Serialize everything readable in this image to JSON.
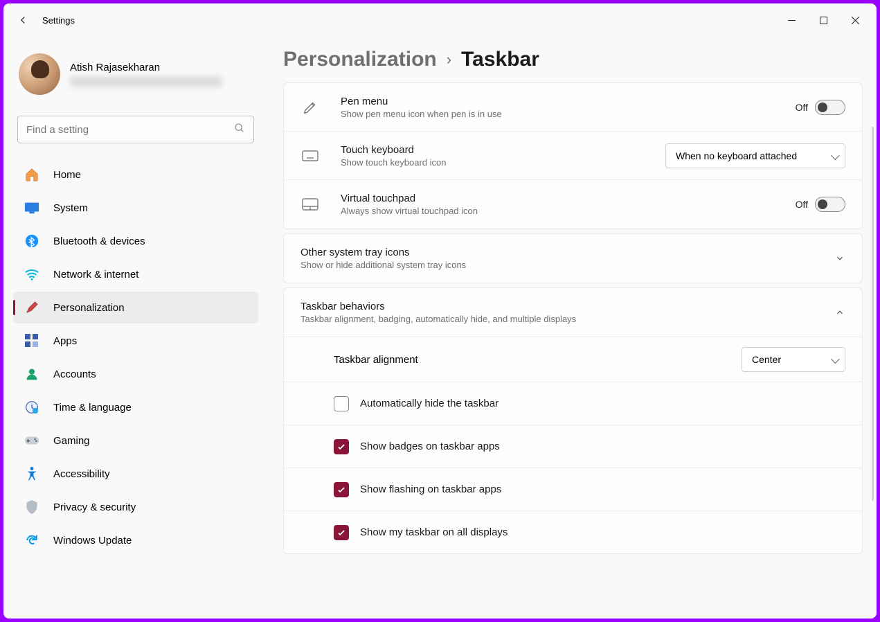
{
  "app": {
    "title": "Settings"
  },
  "wincontrols": {
    "min": "–",
    "max": "▢",
    "close": "✕"
  },
  "profile": {
    "name": "Atish Rajasekharan"
  },
  "search": {
    "placeholder": "Find a setting"
  },
  "nav": {
    "items": [
      {
        "label": "Home",
        "icon": "home"
      },
      {
        "label": "System",
        "icon": "system"
      },
      {
        "label": "Bluetooth & devices",
        "icon": "bluetooth"
      },
      {
        "label": "Network & internet",
        "icon": "wifi"
      },
      {
        "label": "Personalization",
        "icon": "brush",
        "active": true
      },
      {
        "label": "Apps",
        "icon": "apps"
      },
      {
        "label": "Accounts",
        "icon": "accounts"
      },
      {
        "label": "Time & language",
        "icon": "time"
      },
      {
        "label": "Gaming",
        "icon": "gaming"
      },
      {
        "label": "Accessibility",
        "icon": "accessibility"
      },
      {
        "label": "Privacy & security",
        "icon": "privacy"
      },
      {
        "label": "Windows Update",
        "icon": "update"
      }
    ]
  },
  "breadcrumb": {
    "parent": "Personalization",
    "current": "Taskbar",
    "chevron": "›"
  },
  "rows": {
    "pen": {
      "title": "Pen menu",
      "desc": "Show pen menu icon when pen is in use",
      "state": "Off"
    },
    "touchkb": {
      "title": "Touch keyboard",
      "desc": "Show touch keyboard icon",
      "selected": "When no keyboard attached"
    },
    "vtouch": {
      "title": "Virtual touchpad",
      "desc": "Always show virtual touchpad icon",
      "state": "Off"
    }
  },
  "othertray": {
    "title": "Other system tray icons",
    "desc": "Show or hide additional system tray icons"
  },
  "behaviors": {
    "title": "Taskbar behaviors",
    "desc": "Taskbar alignment, badging, automatically hide, and multiple displays",
    "alignment": {
      "label": "Taskbar alignment",
      "selected": "Center"
    },
    "opts": {
      "autohide": {
        "label": "Automatically hide the taskbar",
        "checked": false
      },
      "badges": {
        "label": "Show badges on taskbar apps",
        "checked": true
      },
      "flashing": {
        "label": "Show flashing on taskbar apps",
        "checked": true
      },
      "alldisplays": {
        "label": "Show my taskbar on all displays",
        "checked": true
      }
    }
  }
}
